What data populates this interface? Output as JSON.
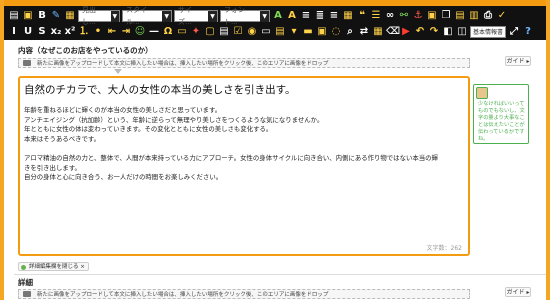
{
  "toolbar": {
    "format_select": "見出し...",
    "style_select": "スタイル...",
    "size_select": "サイズ...",
    "font_select": "フォント...",
    "mode_select": "基本情報書"
  },
  "section1": {
    "title": "内容（なぜこのお店をやっているのか）",
    "upload_text": "新たに画像をアップロードして本文に挿入したい場合は、挿入したい場所をクリック後、このエリアに画像をドロップ",
    "guide_label": "ガイド ▸"
  },
  "editor": {
    "heading": "自然のチカラで、大人の女性の本当の美しさを引き出す。",
    "paragraphs": [
      "年齢を重ねるほどに輝くのが本当の女性の美しさだと思っています。",
      "アンチエイジング（抗加齢）という、年齢に逆らって無理やり美しさをつくるような気になりませんか。",
      "年とともに女性の体は変わっていきます。その変化とともに女性の美しさも変化する。",
      "本来はそうあるべきです。",
      "",
      "アロマ精油の自然の力と、整体で、人間が本来持っている力にアプローチ。女性の身体サイクルに向き合い、内側にある作り物ではない本当の輝",
      "きを引き出します。",
      "自分の身体と心に向き合う、お一人だけの時間をお楽しみください。"
    ],
    "char_count": "文字数：262"
  },
  "hint": {
    "text": "少なければいいってものでもないし、文字の量より大事なことは伝えたいことが伝わっているかですね。"
  },
  "tag": {
    "label": "詳細編集欄を閉じる ×"
  },
  "section2": {
    "title": "詳細",
    "upload_text": "新たに画像をアップロードして本文に挿入したい場合は、挿入したい場所をクリック後、このエリアに画像をドロップ",
    "guide_label": "ガイド ▸"
  },
  "colors": {
    "accent": "#f39c12",
    "hint_green": "#4caf50",
    "toolbar_bg": "#111111"
  }
}
